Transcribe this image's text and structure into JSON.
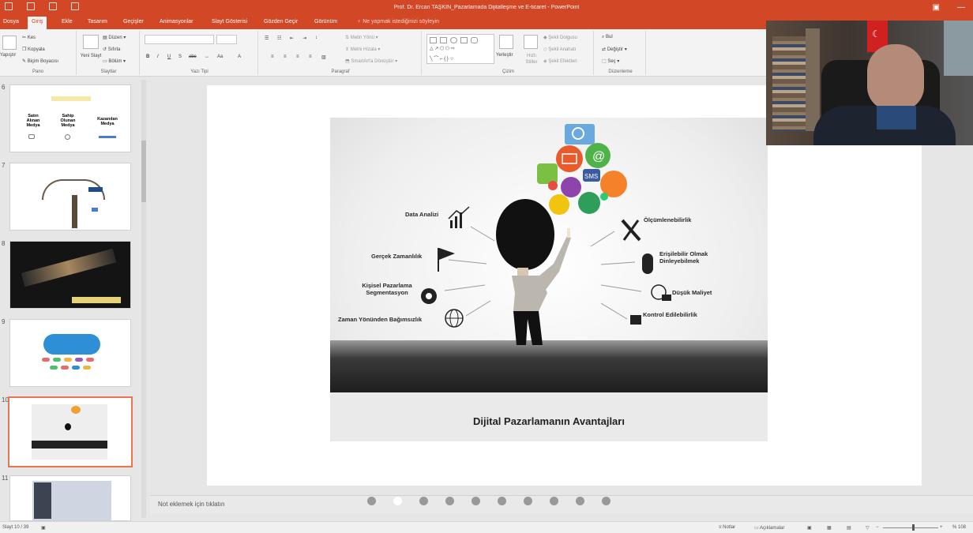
{
  "window": {
    "title": "Prof. Dr. Ercan TAŞKIN_Pazarlamada Dijitalleşme ve E-ticaret - PowerPoint"
  },
  "tabs": [
    {
      "label": "Dosya"
    },
    {
      "label": "Giriş"
    },
    {
      "label": "Ekle"
    },
    {
      "label": "Tasarım"
    },
    {
      "label": "Geçişler"
    },
    {
      "label": "Animasyonlar"
    },
    {
      "label": "Slayt Gösterisi"
    },
    {
      "label": "Gözden Geçir"
    },
    {
      "label": "Görünüm"
    }
  ],
  "tell_me": "Ne yapmak istediğinizi söyleyin",
  "ribbon": {
    "clipboard": {
      "paste": "Yapıştır",
      "cut": "Kes",
      "copy": "Kopyala",
      "format_painter": "Biçim Boyacısı",
      "label": "Pano"
    },
    "slides": {
      "new_slide": "Yeni Slayt",
      "layout": "Düzen",
      "reset": "Sıfırla",
      "section": "Bölüm",
      "label": "Slaytlar"
    },
    "font": {
      "label": "Yazı Tipi"
    },
    "paragraph": {
      "text_direction": "Metin Yönü",
      "align_text": "Metni Hizala",
      "smartart": "SmartArt'a Dönüştür",
      "label": "Paragraf"
    },
    "drawing": {
      "arrange": "Yerleştir",
      "quick_styles": "Hızlı Stiller",
      "shape_fill": "Şekil Dolgusu",
      "shape_outline": "Şekil Anahatı",
      "shape_effects": "Şekil Efektleri",
      "label": "Çizim"
    },
    "editing": {
      "find": "Bul",
      "replace": "Değiştir",
      "select": "Seç",
      "label": "Düzenleme"
    }
  },
  "thumbnails": [
    {
      "number": "6",
      "texts": [
        "Satın Alınan Medya",
        "Sahip Olunan Medya",
        "Kazanılan Medya"
      ]
    },
    {
      "number": "7"
    },
    {
      "number": "8"
    },
    {
      "number": "9"
    },
    {
      "number": "10"
    },
    {
      "number": "11"
    }
  ],
  "slide": {
    "caption": "Dijital Pazarlamanın Avantajları",
    "left_labels": [
      "Data Analizi",
      "Gerçek Zamanlılık",
      "Kişisel Pazarlama Segmentasyon",
      "Zaman Yönünden Bağımsızlık"
    ],
    "right_labels": [
      "Ölçümlenebilirlik",
      "Erişilebilir Olmak Dinleyebilmek",
      "Düşük Maliyet",
      "Kontrol Edilebilirlik"
    ],
    "sms": "SMS"
  },
  "notes": {
    "placeholder": "Not eklemek için tıklatın"
  },
  "status": {
    "slide_counter": "Slayt 10 / 39",
    "notes": "Notlar",
    "comments": "Açıklamalar",
    "zoom": "% 108"
  },
  "colors": {
    "accent": "#d24726",
    "selected_thumb": "#e8754f"
  }
}
